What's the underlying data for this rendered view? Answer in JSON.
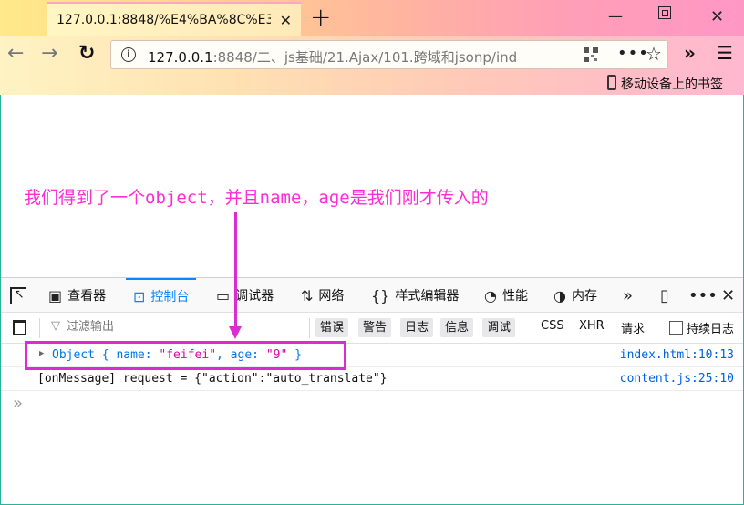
{
  "browser": {
    "tab_title": "127.0.0.1:8848/%E4%BA%8C%E3",
    "tab_close": "✕",
    "new_tab": "+",
    "url_host": "127.0.0.1",
    "url_rest": ":8848/二、js基础/21.Ajax/101.跨域和jsonp/ind",
    "bookmark_label": "移动设备上的书签"
  },
  "annotation": {
    "text": "我们得到了一个object，并且name，age是我们刚才传入的",
    "color": "#ff2bd4"
  },
  "devtools": {
    "tabs": [
      {
        "label": "查看器",
        "icon": "inspector-icon"
      },
      {
        "label": "控制台",
        "icon": "console-icon",
        "active": true
      },
      {
        "label": "调试器",
        "icon": "debugger-icon"
      },
      {
        "label": "网络",
        "icon": "network-icon"
      },
      {
        "label": "样式编辑器",
        "icon": "style-editor-icon"
      },
      {
        "label": "性能",
        "icon": "performance-icon"
      },
      {
        "label": "内存",
        "icon": "memory-icon"
      }
    ],
    "filter_placeholder": "过滤输出",
    "filter_buttons": [
      "错误",
      "警告",
      "日志",
      "信息",
      "调试"
    ],
    "filter_plain": [
      "CSS",
      "XHR",
      "请求"
    ],
    "persist_label": "持续日志"
  },
  "console": {
    "rows": [
      {
        "prefix": "Object { name: ",
        "name_val": "\"feifei\"",
        "mid": ", age: ",
        "age_val": "\"9\"",
        "suffix": " }",
        "location": "index.html:10:13"
      },
      {
        "text": "[onMessage] request = {\"action\":\"auto_translate\"}",
        "location": "content.js:25:10"
      }
    ],
    "prompt": "»"
  }
}
